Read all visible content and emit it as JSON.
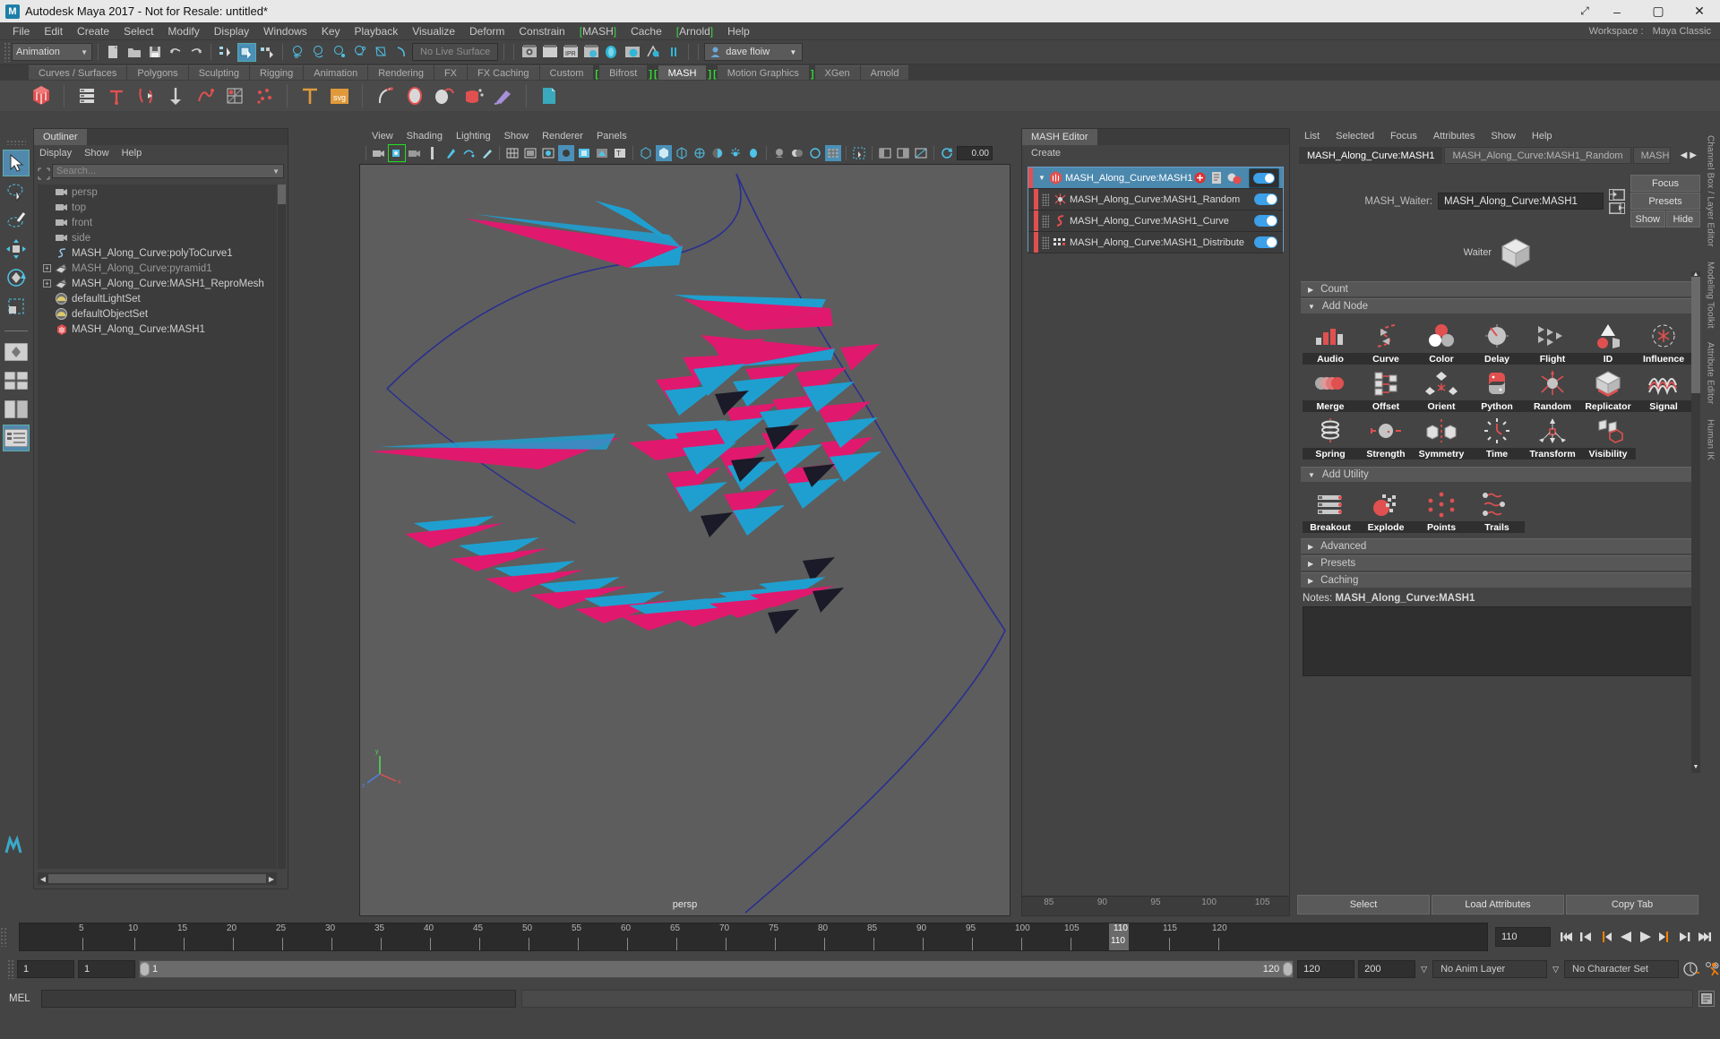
{
  "window": {
    "title": "Autodesk Maya 2017 - Not for Resale: untitled*",
    "logo_letter": "M",
    "btn_restore_down": "⤢",
    "btn_minimize": "–",
    "btn_maximize": "▢",
    "btn_close": "✕"
  },
  "menubar": {
    "items": [
      "File",
      "Edit",
      "Create",
      "Select",
      "Modify",
      "Display",
      "Windows",
      "Key",
      "Playback",
      "Visualize",
      "Deform",
      "Constrain",
      "MASH",
      "Cache",
      "Arnold",
      "Help"
    ],
    "bracketed": [
      "MASH",
      "Arnold"
    ],
    "workspace_label": "Workspace :",
    "workspace_value": "Maya Classic"
  },
  "statusbar": {
    "menu_set": "Animation",
    "live_surface": "No Live Surface",
    "user_name": "dave floiw"
  },
  "shelf": {
    "tabs": [
      "Curves / Surfaces",
      "Polygons",
      "Sculpting",
      "Rigging",
      "Animation",
      "Rendering",
      "FX",
      "FX Caching",
      "Custom",
      "Bifrost",
      "MASH",
      "Motion Graphics",
      "XGen",
      "Arnold"
    ],
    "bracketed": [
      "Bifrost",
      "MASH",
      "Motion Graphics"
    ],
    "active": "MASH",
    "svg_label": "svg",
    "text_tool_label": "T"
  },
  "outliner": {
    "tab": "Outliner",
    "menus": [
      "Display",
      "Show",
      "Help"
    ],
    "search_placeholder": "Search...",
    "items": [
      {
        "label": "persp",
        "icon": "camera-icon",
        "expandable": false,
        "dim": true
      },
      {
        "label": "top",
        "icon": "camera-icon",
        "expandable": false,
        "dim": true
      },
      {
        "label": "front",
        "icon": "camera-icon",
        "expandable": false,
        "dim": true
      },
      {
        "label": "side",
        "icon": "camera-icon",
        "expandable": false,
        "dim": true
      },
      {
        "label": "MASH_Along_Curve:polyToCurve1",
        "icon": "curve-icon",
        "expandable": false,
        "dim": false
      },
      {
        "label": "MASH_Along_Curve:pyramid1",
        "icon": "mesh-icon",
        "expandable": true,
        "dim": true
      },
      {
        "label": "MASH_Along_Curve:MASH1_ReproMesh",
        "icon": "mesh-icon",
        "expandable": true,
        "dim": false
      },
      {
        "label": "defaultLightSet",
        "icon": "set-icon",
        "expandable": false,
        "dim": false
      },
      {
        "label": "defaultObjectSet",
        "icon": "set-icon",
        "expandable": false,
        "dim": false
      },
      {
        "label": "MASH_Along_Curve:MASH1",
        "icon": "mash-waiter-icon",
        "expandable": false,
        "dim": false
      }
    ]
  },
  "viewport": {
    "menus": [
      "View",
      "Shading",
      "Lighting",
      "Show",
      "Renderer",
      "Panels"
    ],
    "camera_label": "persp",
    "exposure_value": "0.00"
  },
  "mash_editor": {
    "tab": "MASH Editor",
    "create_menu": "Create",
    "nodes": [
      {
        "label": "MASH_Along_Curve:MASH1",
        "icon": "mash-waiter-icon",
        "selected": true,
        "child": false
      },
      {
        "label": "MASH_Along_Curve:MASH1_Random",
        "icon": "random-node-icon",
        "selected": false,
        "child": true
      },
      {
        "label": "MASH_Along_Curve:MASH1_Curve",
        "icon": "curve-node-icon",
        "selected": false,
        "child": true
      },
      {
        "label": "MASH_Along_Curve:MASH1_Distribute",
        "icon": "distribute-node-icon",
        "selected": false,
        "child": true
      }
    ],
    "timeline_ticks": [
      "85",
      "90",
      "95",
      "100",
      "105"
    ]
  },
  "attribute_editor": {
    "menus": [
      "List",
      "Selected",
      "Focus",
      "Attributes",
      "Show",
      "Help"
    ],
    "tabs": [
      {
        "label": "MASH_Along_Curve:MASH1",
        "active": true
      },
      {
        "label": "MASH_Along_Curve:MASH1_Random",
        "active": false
      },
      {
        "label": "MASH",
        "active": false
      }
    ],
    "tab_prev": "◀",
    "tab_next": "▶",
    "waiter_label": "MASH_Waiter:",
    "waiter_value": "MASH_Along_Curve:MASH1",
    "buttons": {
      "focus": "Focus",
      "presets": "Presets",
      "show": "Show",
      "hide": "Hide"
    },
    "waiter_caption": "Waiter",
    "sections": {
      "count": "Count",
      "add_node": "Add Node",
      "add_utility": "Add Utility",
      "advanced": "Advanced",
      "presets": "Presets",
      "caching": "Caching"
    },
    "add_node_items": [
      {
        "label": "Audio",
        "icon": "audio-node-icon"
      },
      {
        "label": "Curve",
        "icon": "curve-node-icon"
      },
      {
        "label": "Color",
        "icon": "color-node-icon"
      },
      {
        "label": "Delay",
        "icon": "delay-node-icon"
      },
      {
        "label": "Flight",
        "icon": "flight-node-icon"
      },
      {
        "label": "ID",
        "icon": "id-node-icon"
      },
      {
        "label": "Influence",
        "icon": "influence-node-icon"
      },
      {
        "label": "Merge",
        "icon": "merge-node-icon"
      },
      {
        "label": "Offset",
        "icon": "offset-node-icon"
      },
      {
        "label": "Orient",
        "icon": "orient-node-icon"
      },
      {
        "label": "Python",
        "icon": "python-node-icon"
      },
      {
        "label": "Random",
        "icon": "random-node-icon"
      },
      {
        "label": "Replicator",
        "icon": "replicator-node-icon"
      },
      {
        "label": "Signal",
        "icon": "signal-node-icon"
      },
      {
        "label": "Spring",
        "icon": "spring-node-icon"
      },
      {
        "label": "Strength",
        "icon": "strength-node-icon"
      },
      {
        "label": "Symmetry",
        "icon": "symmetry-node-icon"
      },
      {
        "label": "Time",
        "icon": "time-node-icon"
      },
      {
        "label": "Transform",
        "icon": "transform-node-icon"
      },
      {
        "label": "Visibility",
        "icon": "visibility-node-icon"
      }
    ],
    "add_utility_items": [
      {
        "label": "Breakout",
        "icon": "breakout-utility-icon"
      },
      {
        "label": "Explode",
        "icon": "explode-utility-icon"
      },
      {
        "label": "Points",
        "icon": "points-utility-icon"
      },
      {
        "label": "Trails",
        "icon": "trails-utility-icon"
      }
    ],
    "notes_label": "Notes:",
    "notes_value": "MASH_Along_Curve:MASH1",
    "notes_text": "",
    "footer_buttons": [
      "Select",
      "Load Attributes",
      "Copy Tab"
    ]
  },
  "right_tabs": [
    "Channel Box / Layer Editor",
    "Modeling Toolkit",
    "Attribute Editor",
    "Human IK"
  ],
  "timeline": {
    "ticks": [
      "5",
      "10",
      "15",
      "20",
      "25",
      "30",
      "35",
      "40",
      "45",
      "50",
      "55",
      "60",
      "65",
      "70",
      "75",
      "80",
      "85",
      "90",
      "95",
      "100",
      "105",
      "110",
      "115",
      "120"
    ],
    "current_frame": "110",
    "current_field": "110",
    "playback_buttons": [
      "go-to-start",
      "step-back-key",
      "step-back-frame",
      "play-backwards",
      "play-forwards",
      "step-forward-frame",
      "step-forward-key",
      "go-to-end"
    ]
  },
  "range": {
    "start_field": "1",
    "anim_start_field": "1",
    "slider_start": "1",
    "slider_end": "120",
    "end_field": "120",
    "anim_end_field": "200",
    "anim_layer": "No Anim Layer",
    "character_set": "No Character Set"
  },
  "command_line": {
    "label": "MEL",
    "input_value": "",
    "output_value": ""
  },
  "colors": {
    "accent_blue": "#4b88ae",
    "mash_red": "#e05050",
    "bracket_green": "#2ee02e",
    "panel_bg": "#444444",
    "viewport_bg": "#5d5d5d",
    "magenta": "#e0196e",
    "cyan": "#1f9fd0",
    "orange": "#ff8000"
  }
}
